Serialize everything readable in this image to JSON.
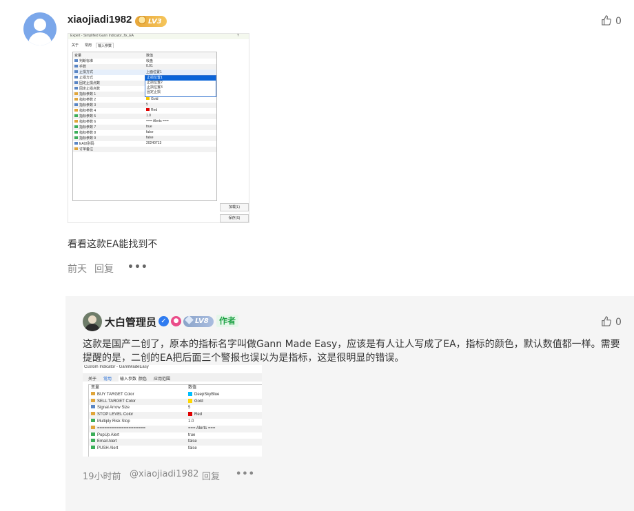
{
  "comment1": {
    "username": "xiaojiadi1982",
    "level": "LV3",
    "like_count": "0",
    "text": "看看这款EA能找到不",
    "time": "前天",
    "reply_label": "回复",
    "more": "•••",
    "screenshot": {
      "title": "Expert - Simplified Gann Indicator_fix_EA",
      "question": "?",
      "tabs": [
        "关于",
        "常用",
        "输入参数"
      ],
      "headers": [
        "变量",
        "数值"
      ],
      "rows": [
        [
          "判断标准",
          "收盘"
        ],
        [
          "手数",
          "0.01"
        ],
        [
          "止损方式",
          "上面位置1"
        ],
        [
          "止损方式",
          ""
        ],
        [
          "固定止损点数",
          ""
        ],
        [
          "固定止损点数",
          ""
        ],
        [
          "指标参数 1",
          ""
        ],
        [
          "指标参数 2",
          "Gold"
        ],
        [
          "指标参数 3",
          "5"
        ],
        [
          "指标参数 4",
          "Red"
        ],
        [
          "指标参数 5",
          "1.0"
        ],
        [
          "指标参数 6",
          "=== Alerts ==="
        ],
        [
          "指标参数 7",
          "true"
        ],
        [
          "指标参数 8",
          "false"
        ],
        [
          "指标参数 9",
          "false"
        ],
        [
          "EA识别码",
          "20240713"
        ],
        [
          "订单备注",
          ""
        ]
      ],
      "dropdown": [
        "止损位置1",
        "止损位置2",
        "止损位置3",
        "固定止损"
      ],
      "buttons": [
        "加载(L)",
        "保存(S)"
      ]
    }
  },
  "comment2": {
    "username": "大白管理员",
    "level": "LV8",
    "author_tag": "作者",
    "like_count": "0",
    "text": "这款是国产二创了，原本的指标名字叫做Gann Made Easy，应该是有人让人写成了EA，指标的颜色，默认数值都一样。需要提醒的是，二创的EA把后面三个警报也误以为是指标，这是很明显的错误。",
    "time": "19小时前",
    "mention": "@xiaojiadi1982",
    "reply_label": "回复",
    "more": "•••",
    "screenshot": {
      "title": "Custom Indicator - GannMadeEasy",
      "tabs": [
        "关于",
        "常用",
        "输入参数",
        "颜色",
        "应用范围"
      ],
      "headers": [
        "变量",
        "数值"
      ],
      "rows": [
        [
          "BUY TARGET Color",
          "DeepSkyBlue"
        ],
        [
          "SELL TARGET Color",
          "Gold"
        ],
        [
          "Signal Arrow Size",
          "5"
        ],
        [
          "STOP LEVEL Color",
          "Red"
        ],
        [
          "Multiply Risk Stop",
          "1.0"
        ],
        [
          "====================",
          "=== Alerts ==="
        ],
        [
          "PopUp Alert",
          "true"
        ],
        [
          "Email Alert",
          "false"
        ],
        [
          "PUSH Alert",
          "false"
        ]
      ]
    }
  },
  "colors": {
    "accent_blue": "#2f7bf0",
    "author_green": "#1fa346",
    "reply_bg": "#f5f5f5"
  },
  "icons": [
    "user-avatar-icon",
    "thumb-up-icon",
    "verified-icon",
    "person-badge-icon",
    "coin-icon",
    "gem-icon"
  ]
}
